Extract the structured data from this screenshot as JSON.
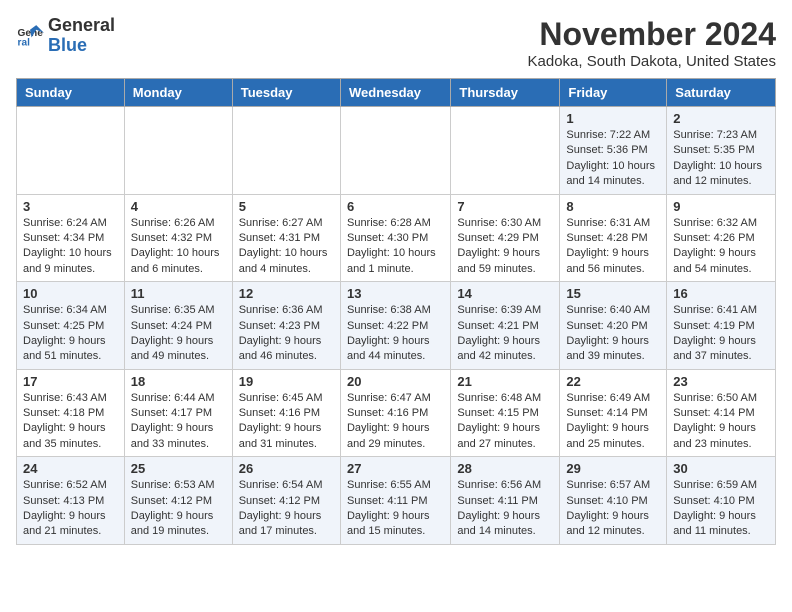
{
  "logo": {
    "line1": "General",
    "line2": "Blue"
  },
  "title": "November 2024",
  "location": "Kadoka, South Dakota, United States",
  "days_of_week": [
    "Sunday",
    "Monday",
    "Tuesday",
    "Wednesday",
    "Thursday",
    "Friday",
    "Saturday"
  ],
  "weeks": [
    [
      {
        "day": "",
        "info": ""
      },
      {
        "day": "",
        "info": ""
      },
      {
        "day": "",
        "info": ""
      },
      {
        "day": "",
        "info": ""
      },
      {
        "day": "",
        "info": ""
      },
      {
        "day": "1",
        "info": "Sunrise: 7:22 AM\nSunset: 5:36 PM\nDaylight: 10 hours and 14 minutes."
      },
      {
        "day": "2",
        "info": "Sunrise: 7:23 AM\nSunset: 5:35 PM\nDaylight: 10 hours and 12 minutes."
      }
    ],
    [
      {
        "day": "3",
        "info": "Sunrise: 6:24 AM\nSunset: 4:34 PM\nDaylight: 10 hours and 9 minutes."
      },
      {
        "day": "4",
        "info": "Sunrise: 6:26 AM\nSunset: 4:32 PM\nDaylight: 10 hours and 6 minutes."
      },
      {
        "day": "5",
        "info": "Sunrise: 6:27 AM\nSunset: 4:31 PM\nDaylight: 10 hours and 4 minutes."
      },
      {
        "day": "6",
        "info": "Sunrise: 6:28 AM\nSunset: 4:30 PM\nDaylight: 10 hours and 1 minute."
      },
      {
        "day": "7",
        "info": "Sunrise: 6:30 AM\nSunset: 4:29 PM\nDaylight: 9 hours and 59 minutes."
      },
      {
        "day": "8",
        "info": "Sunrise: 6:31 AM\nSunset: 4:28 PM\nDaylight: 9 hours and 56 minutes."
      },
      {
        "day": "9",
        "info": "Sunrise: 6:32 AM\nSunset: 4:26 PM\nDaylight: 9 hours and 54 minutes."
      }
    ],
    [
      {
        "day": "10",
        "info": "Sunrise: 6:34 AM\nSunset: 4:25 PM\nDaylight: 9 hours and 51 minutes."
      },
      {
        "day": "11",
        "info": "Sunrise: 6:35 AM\nSunset: 4:24 PM\nDaylight: 9 hours and 49 minutes."
      },
      {
        "day": "12",
        "info": "Sunrise: 6:36 AM\nSunset: 4:23 PM\nDaylight: 9 hours and 46 minutes."
      },
      {
        "day": "13",
        "info": "Sunrise: 6:38 AM\nSunset: 4:22 PM\nDaylight: 9 hours and 44 minutes."
      },
      {
        "day": "14",
        "info": "Sunrise: 6:39 AM\nSunset: 4:21 PM\nDaylight: 9 hours and 42 minutes."
      },
      {
        "day": "15",
        "info": "Sunrise: 6:40 AM\nSunset: 4:20 PM\nDaylight: 9 hours and 39 minutes."
      },
      {
        "day": "16",
        "info": "Sunrise: 6:41 AM\nSunset: 4:19 PM\nDaylight: 9 hours and 37 minutes."
      }
    ],
    [
      {
        "day": "17",
        "info": "Sunrise: 6:43 AM\nSunset: 4:18 PM\nDaylight: 9 hours and 35 minutes."
      },
      {
        "day": "18",
        "info": "Sunrise: 6:44 AM\nSunset: 4:17 PM\nDaylight: 9 hours and 33 minutes."
      },
      {
        "day": "19",
        "info": "Sunrise: 6:45 AM\nSunset: 4:16 PM\nDaylight: 9 hours and 31 minutes."
      },
      {
        "day": "20",
        "info": "Sunrise: 6:47 AM\nSunset: 4:16 PM\nDaylight: 9 hours and 29 minutes."
      },
      {
        "day": "21",
        "info": "Sunrise: 6:48 AM\nSunset: 4:15 PM\nDaylight: 9 hours and 27 minutes."
      },
      {
        "day": "22",
        "info": "Sunrise: 6:49 AM\nSunset: 4:14 PM\nDaylight: 9 hours and 25 minutes."
      },
      {
        "day": "23",
        "info": "Sunrise: 6:50 AM\nSunset: 4:14 PM\nDaylight: 9 hours and 23 minutes."
      }
    ],
    [
      {
        "day": "24",
        "info": "Sunrise: 6:52 AM\nSunset: 4:13 PM\nDaylight: 9 hours and 21 minutes."
      },
      {
        "day": "25",
        "info": "Sunrise: 6:53 AM\nSunset: 4:12 PM\nDaylight: 9 hours and 19 minutes."
      },
      {
        "day": "26",
        "info": "Sunrise: 6:54 AM\nSunset: 4:12 PM\nDaylight: 9 hours and 17 minutes."
      },
      {
        "day": "27",
        "info": "Sunrise: 6:55 AM\nSunset: 4:11 PM\nDaylight: 9 hours and 15 minutes."
      },
      {
        "day": "28",
        "info": "Sunrise: 6:56 AM\nSunset: 4:11 PM\nDaylight: 9 hours and 14 minutes."
      },
      {
        "day": "29",
        "info": "Sunrise: 6:57 AM\nSunset: 4:10 PM\nDaylight: 9 hours and 12 minutes."
      },
      {
        "day": "30",
        "info": "Sunrise: 6:59 AM\nSunset: 4:10 PM\nDaylight: 9 hours and 11 minutes."
      }
    ]
  ]
}
